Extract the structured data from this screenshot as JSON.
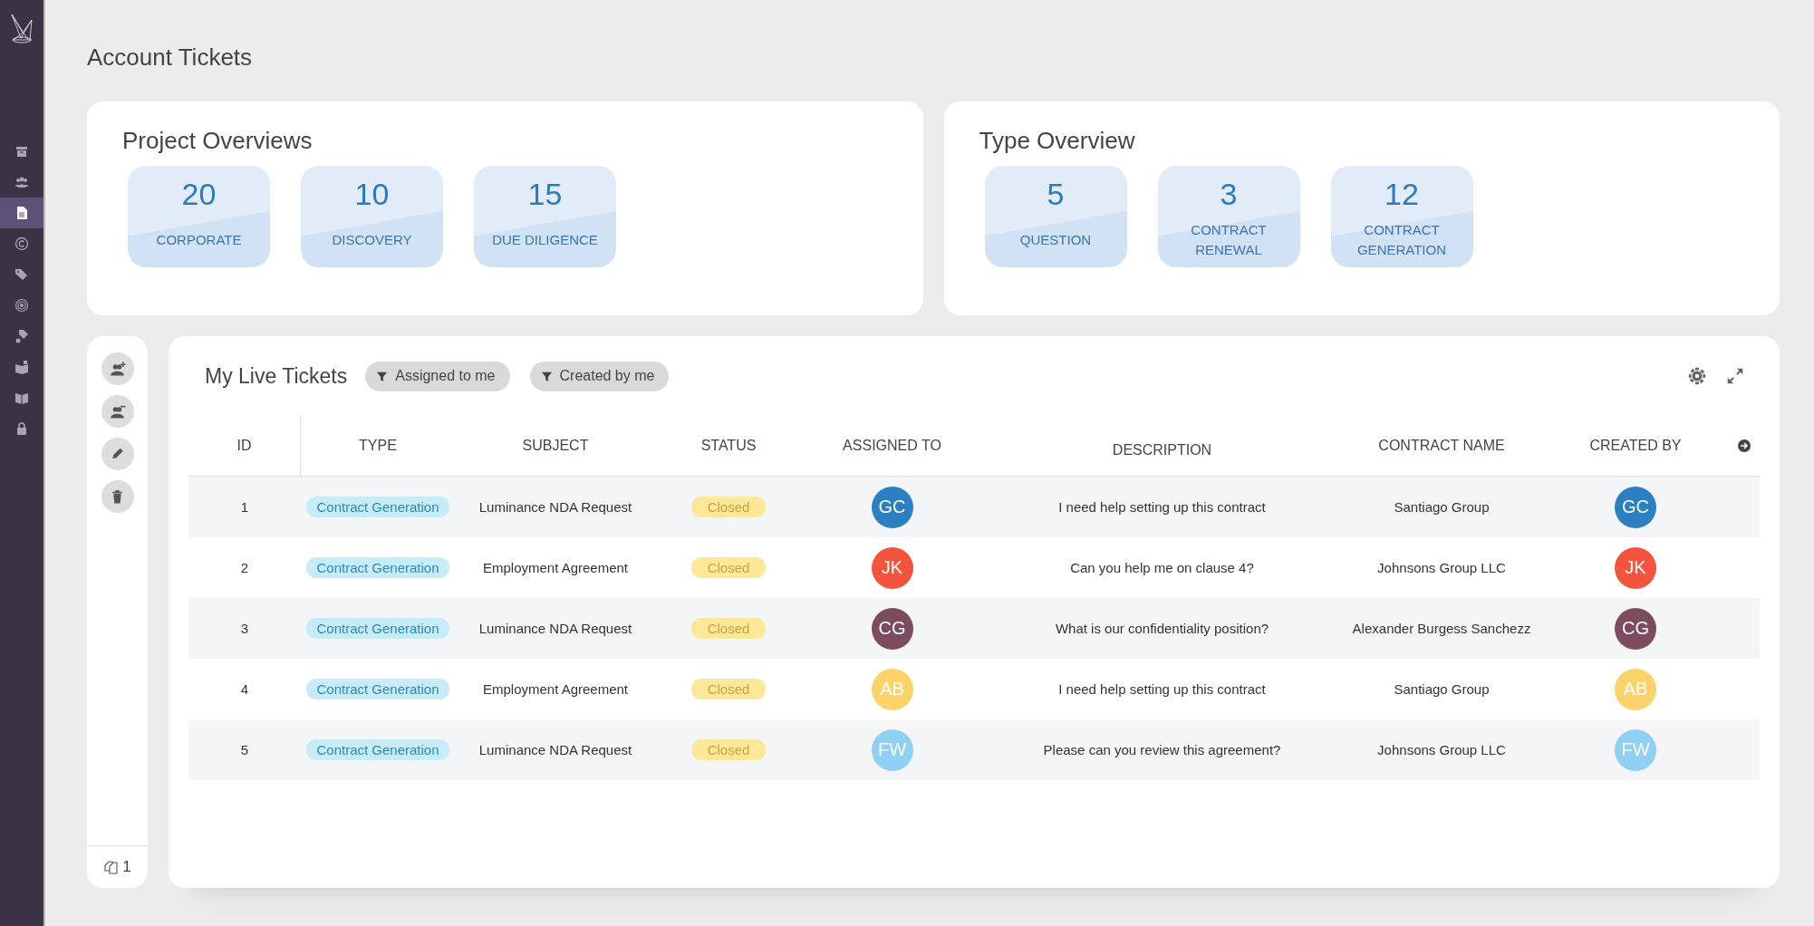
{
  "sidebar": {
    "items": [
      {
        "selected": false
      },
      {
        "selected": false
      },
      {
        "selected": true
      },
      {
        "selected": false
      },
      {
        "selected": false
      },
      {
        "selected": false
      },
      {
        "selected": false
      },
      {
        "selected": false
      },
      {
        "selected": false
      },
      {
        "selected": false
      }
    ]
  },
  "page_title": "Account Tickets",
  "overviews": [
    {
      "title": "Project Overviews",
      "tiles": [
        {
          "count": "20",
          "label": "CORPORATE"
        },
        {
          "count": "10",
          "label": "DISCOVERY"
        },
        {
          "count": "15",
          "label": "DUE DILIGENCE"
        }
      ]
    },
    {
      "title": "Type Overview",
      "tiles": [
        {
          "count": "5",
          "label": "QUESTION"
        },
        {
          "count": "3",
          "label": "CONTRACT RENEWAL"
        },
        {
          "count": "12",
          "label": "CONTRACT GENERATION"
        }
      ]
    }
  ],
  "tool_column": {
    "buttons": [
      {
        "kind": "add-user"
      },
      {
        "kind": "remove-user"
      },
      {
        "kind": "edit"
      },
      {
        "kind": "delete"
      }
    ],
    "count": "1"
  },
  "tickets": {
    "title": "My Live Tickets",
    "filters": [
      "Assigned to me",
      "Created by me"
    ],
    "columns": [
      "ID",
      "TYPE",
      "SUBJECT",
      "STATUS",
      "ASSIGNED TO",
      "DESCRIPTION",
      "CONTRACT NAME",
      "CREATED BY"
    ],
    "rows": [
      {
        "id": "1",
        "type": "Contract Generation",
        "subject": "Luminance NDA Request",
        "status": "Closed",
        "assigned": {
          "initials": "GC",
          "color": "#2b7fc3"
        },
        "description": "I need help setting up this contract",
        "contract": "Santiago Group",
        "created": {
          "initials": "GC",
          "color": "#2b7fc3"
        }
      },
      {
        "id": "2",
        "type": "Contract Generation",
        "subject": "Employment Agreement",
        "status": "Closed",
        "assigned": {
          "initials": "JK",
          "color": "#f4533c"
        },
        "description": "Can you help me on clause 4?",
        "contract": "Johnsons Group LLC",
        "created": {
          "initials": "JK",
          "color": "#f4533c"
        }
      },
      {
        "id": "3",
        "type": "Contract Generation",
        "subject": "Luminance NDA Request",
        "status": "Closed",
        "assigned": {
          "initials": "CG",
          "color": "#7c4c5e"
        },
        "description": "What is our confidentiality position?",
        "contract": "Alexander Burgess Sanchezz",
        "created": {
          "initials": "CG",
          "color": "#7c4c5e"
        }
      },
      {
        "id": "4",
        "type": "Contract Generation",
        "subject": "Employment Agreement",
        "status": "Closed",
        "assigned": {
          "initials": "AB",
          "color": "#fcd36a"
        },
        "description": "I need help setting up this contract",
        "contract": "Santiago Group",
        "created": {
          "initials": "AB",
          "color": "#fcd36a"
        }
      },
      {
        "id": "5",
        "type": "Contract Generation",
        "subject": "Luminance NDA Request",
        "status": "Closed",
        "assigned": {
          "initials": "FW",
          "color": "#8fd0f4"
        },
        "description": "Please can you review this agreement?",
        "contract": "Johnsons Group LLC",
        "created": {
          "initials": "FW",
          "color": "#8fd0f4"
        }
      }
    ]
  }
}
